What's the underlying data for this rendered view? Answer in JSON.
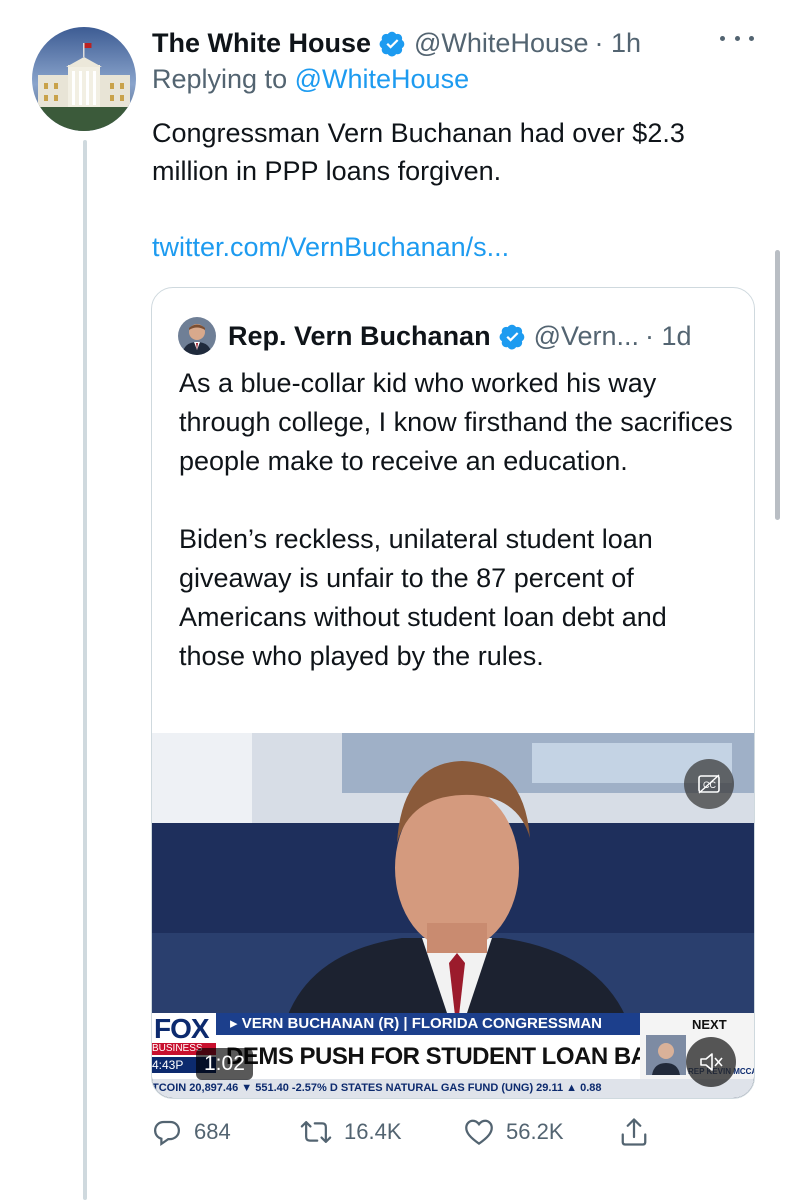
{
  "tweet": {
    "author_name": "The White House",
    "handle": "@WhiteHouse",
    "time": "· 1h",
    "replying_prefix": "Replying to",
    "replying_handle": "@WhiteHouse",
    "text": "Congressman Vern Buchanan had over $2.3 million in PPP loans forgiven.",
    "link": "twitter.com/VernBuchanan/s...",
    "verified_color": "#1d9bf0"
  },
  "quote": {
    "author_name": "Rep. Vern Buchanan",
    "handle": "@Vern...",
    "time": "· 1d",
    "text": "As a blue-collar kid who worked his way through college, I know firsthand the sacrifices people make to receive an education.\n\nBiden’s reckless, unilateral student loan giveaway is unfair to the 87 percent of Americans without student loan debt and those who played by the rules.",
    "video": {
      "duration": "1:02",
      "lower_third_name": "▸ VERN BUCHANAN (R) | FLORIDA CONGRESSMAN",
      "headline": "DEMS PUSH FOR STUDENT LOAN BAILOUT",
      "network_logo": "FOX",
      "network_sub": "BUSINESS",
      "clock": "4:43P",
      "ticker": "TCOIN 20,897.46 ▼ 551.40 -2.57%   D STATES NATURAL GAS FUND (UNG) 29.11 ▲ 0.88",
      "next_label": "NEXT",
      "next_caption": "REP KEVIN MCCARTHY"
    }
  },
  "actions": {
    "replies": "684",
    "retweets": "16.4K",
    "likes": "56.2K"
  }
}
